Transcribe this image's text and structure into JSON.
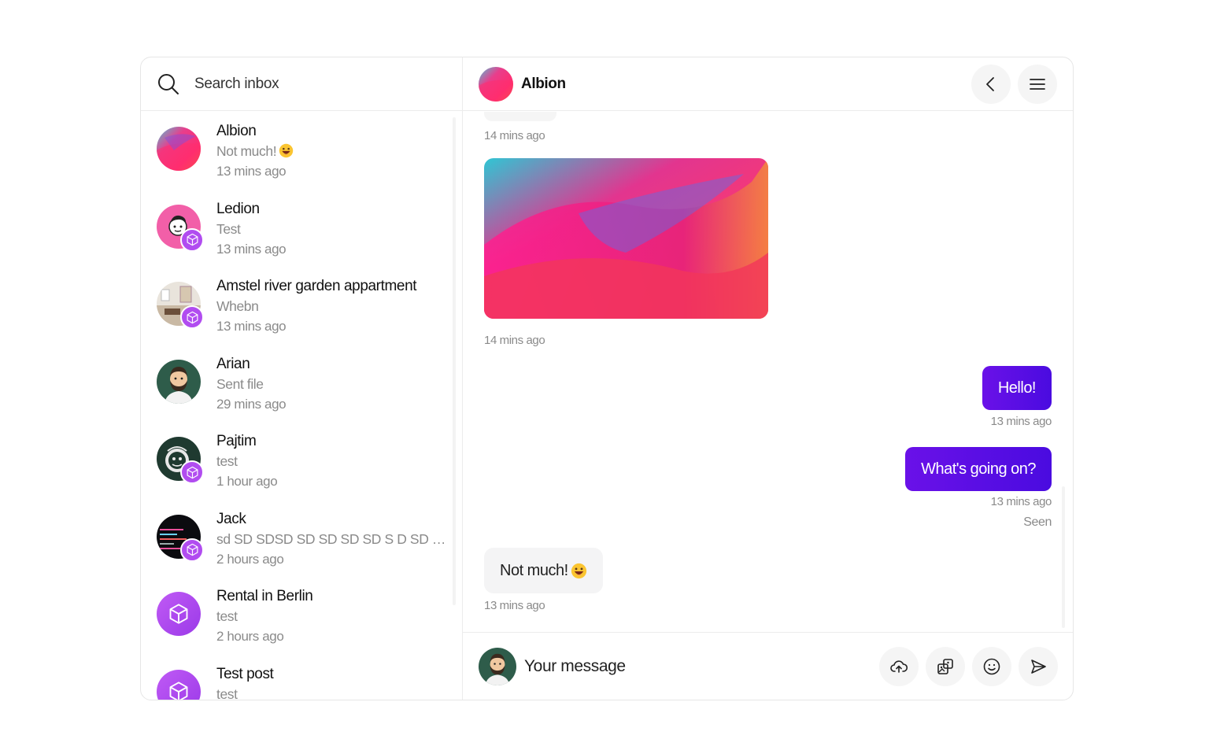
{
  "search": {
    "placeholder": "Search inbox",
    "icon": "search-icon"
  },
  "conversations": [
    {
      "name": "Albion",
      "preview": "Not much!",
      "preview_emoji": "grinning-face-emoji",
      "time": "13 mins ago",
      "avatar": "gradient-avatar",
      "badge": false
    },
    {
      "name": "Ledion",
      "preview": "Test",
      "time": "13 mins ago",
      "avatar": "cartoon-avatar",
      "badge": true
    },
    {
      "name": "Amstel river garden appartment",
      "preview": "Whebn",
      "time": "13 mins ago",
      "avatar": "apartment-photo",
      "badge": true
    },
    {
      "name": "Arian",
      "preview": "Sent file",
      "time": "29 mins ago",
      "avatar": "bearded-man-avatar",
      "badge": false
    },
    {
      "name": "Pajtim",
      "preview": "test",
      "time": "1 hour ago",
      "avatar": "monkey-avatar",
      "badge": true
    },
    {
      "name": "Jack",
      "preview": "sd SD SDSD SD SD SD SD S D SD SD SD SD",
      "time": "2 hours ago",
      "avatar": "code-avatar",
      "badge": true
    },
    {
      "name": "Rental in Berlin",
      "preview": "test",
      "time": "2 hours ago",
      "avatar": "cube-avatar",
      "badge": false
    },
    {
      "name": "Test post",
      "preview": "test",
      "time": "",
      "avatar": "cube-avatar",
      "badge": false
    }
  ],
  "chat": {
    "title": "Albion",
    "back_icon": "chevron-left-icon",
    "menu_icon": "hamburger-menu-icon",
    "messages": [
      {
        "type": "incoming-stub",
        "time": "14 mins ago"
      },
      {
        "type": "incoming-image",
        "time": "14 mins ago"
      },
      {
        "type": "outgoing",
        "text": "Hello!",
        "time": "13 mins ago"
      },
      {
        "type": "outgoing",
        "text": "What's going on?",
        "time": "13 mins ago",
        "status": "Seen"
      },
      {
        "type": "incoming",
        "text": "Not much!",
        "emoji": "grinning-face-emoji",
        "time": "13 mins ago"
      }
    ]
  },
  "composer": {
    "placeholder": "Your message",
    "upload_icon": "cloud-upload-icon",
    "gallery_icon": "image-gallery-icon",
    "emoji_icon": "smiley-icon",
    "send_icon": "send-icon"
  },
  "colors": {
    "accent": "#5b0fe6",
    "badge": "#b14cf0",
    "muted_text": "#8a8a8a",
    "border": "#ececec"
  }
}
